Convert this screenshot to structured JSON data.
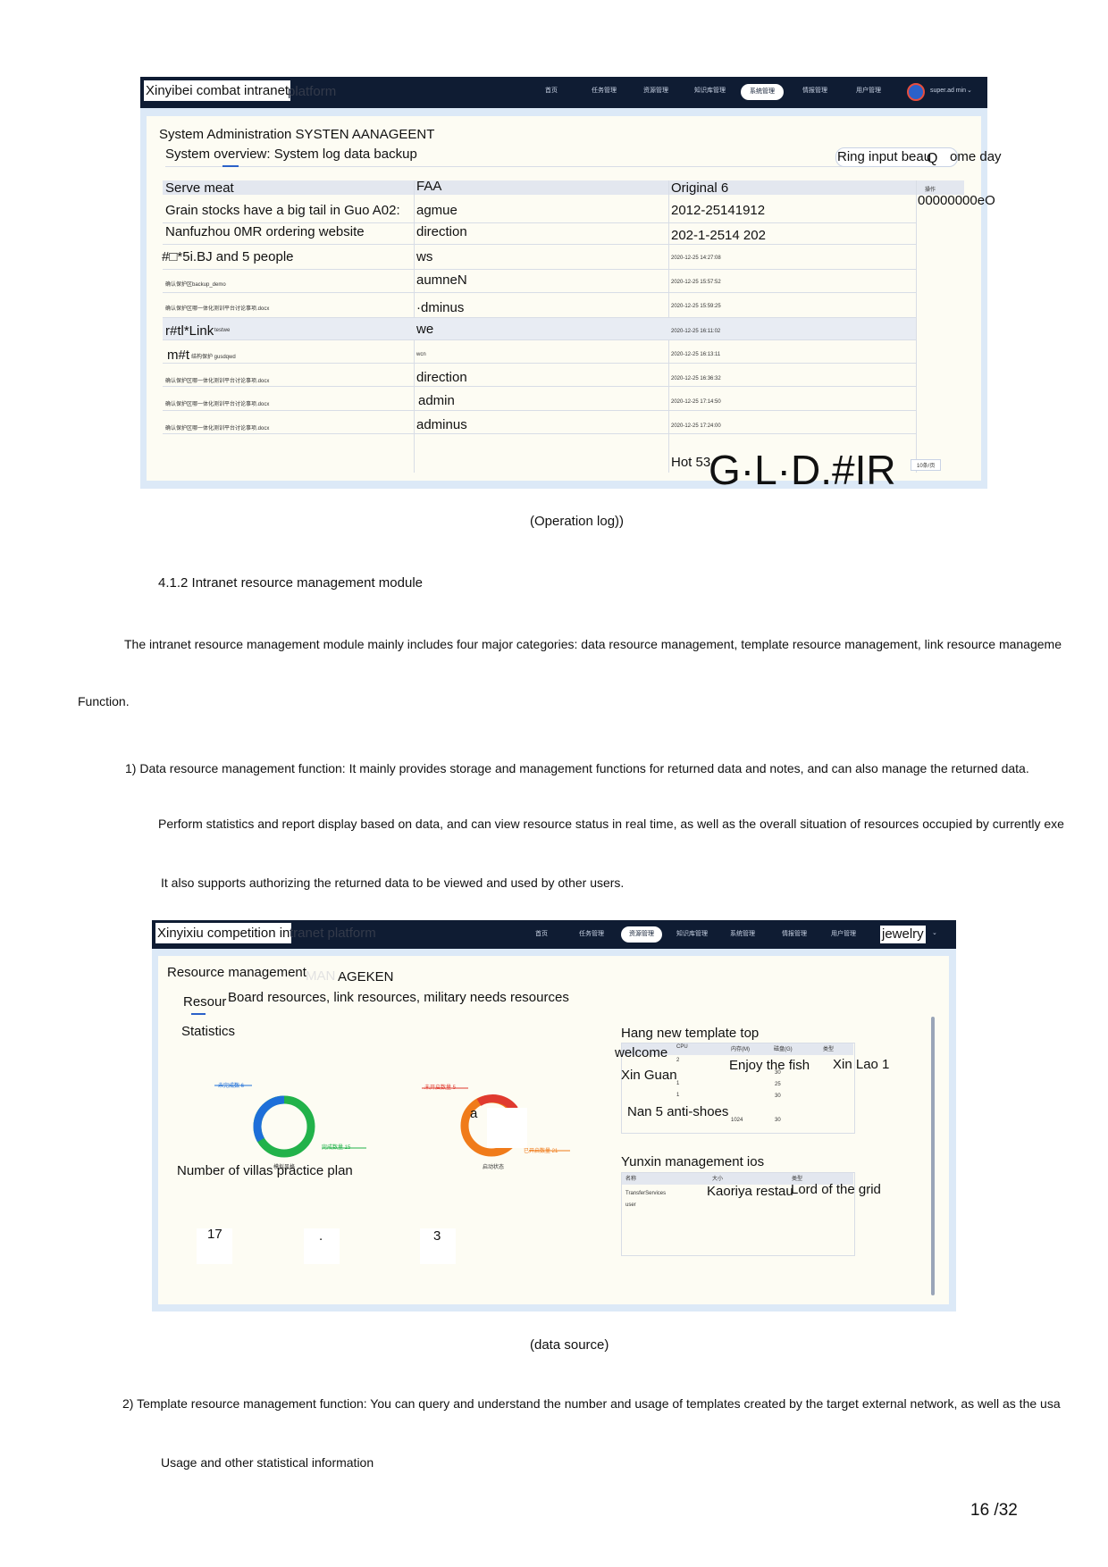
{
  "shot1": {
    "brand": "Xinyibei combat intranet",
    "brand_ghost": "platform",
    "nav": [
      "首页",
      "任务管理",
      "资源管理",
      "知识库管理",
      "系统管理",
      "情报管理",
      "用户管理"
    ],
    "nav_active_index": 4,
    "user": "super.ad min",
    "page_title": "System Administration SYSTEN AANAGEENT",
    "tabs": "System overview: System log data backup",
    "search_placeholder": "Ring input beau",
    "search_icon": "Q",
    "search_suffix": "ome day",
    "headers": {
      "c1": "Serve meat",
      "c2": "FAA",
      "c3": "Original 6",
      "c4": "操作"
    },
    "side_value": "00000000eO",
    "rows": [
      {
        "c1": "Grain stocks have a big tail in Guo A02:",
        "c2": "agmue",
        "c3": "2012-25141912"
      },
      {
        "c1": "Nanfuzhou 0MR ordering website",
        "c2": "direction",
        "c3": "202-1-2514 202"
      },
      {
        "c1": "#□*5i.BJ and 5 people",
        "c2": "ws",
        "c3": "2020-12-25 14:27:08"
      },
      {
        "c1": "确认保护区backup_demo",
        "c2": "aumneN",
        "c3": "2020-12-25 15:57:52"
      },
      {
        "c1": "确认保护区哪一体化测训平台讨论事项.docx",
        "c2": "·dminus",
        "c3": "2020-12-25 15:59:25"
      },
      {
        "c1": "r#tl*Link",
        "c1b": "testwe",
        "c2": "we",
        "c3": "2020-12-25 16:11:02"
      },
      {
        "c1": "m#t",
        "c1b": "结构保护 gusdqwd",
        "c2": "wcn",
        "c3": "2020-12-25 16:13:11"
      },
      {
        "c1": "确认保护区哪一体化测训平台讨论事项.docx",
        "c2": "direction",
        "c3": "2020-12-25 16:36:32"
      },
      {
        "c1": "确认保护区哪一体化测训平台讨论事项.docx",
        "c2": "admin",
        "c3": "2020-12-25 17:14:50"
      },
      {
        "c1": "确认保护区哪一体化测训平台讨论事项.docx",
        "c2": "adminus",
        "c3": "2020-12-25 17:24:00"
      }
    ],
    "footer_label": "Hot 53",
    "footer_big": "G·L·D.#IR",
    "page_size": "10条/页"
  },
  "caption1": "(Operation log))",
  "heading": "4.1.2 Intranet resource management module",
  "para1_line1": "The intranet resource management module mainly includes four major categories: data resource management, template resource management, link resource manageme",
  "para1_line2": "Function.",
  "item1_line1": "1) Data resource management function: It mainly provides storage and management functions for returned data and notes, and can also manage the returned data.",
  "item1_line2": "Perform statistics and report display based on data, and can view resource status in real time, as well as the overall situation of resources occupied by currently exe",
  "item1_line3": "It also supports authorizing the returned data to be viewed and used by other users.",
  "shot2": {
    "brand": "Xinyixiu competition in",
    "brand_ghost": "tranet platform",
    "nav": [
      "首页",
      "任务管理",
      "资源管理",
      "知识库管理",
      "系统管理",
      "情报管理",
      "用户管理"
    ],
    "nav_active_index": 2,
    "user": "jewelry",
    "title": "Resource management",
    "title_ghost": "MAN",
    "title_tail": "AGEKEN",
    "tabs_prefix": "Resour",
    "tabs": "Board resources, link resources, military needs resources",
    "stats_title": "Statistics",
    "donut1": {
      "label_a": "未完成数 6",
      "label_b": "完成数量 15",
      "caption": "模拟风格"
    },
    "donut2": {
      "label_a": "未开启数量 5",
      "label_b": "已开启数量 21",
      "caption": "启动状态",
      "center": "a"
    },
    "plan_title": "Number of villas practice plan",
    "plan_values": [
      "17",
      ".",
      "3"
    ],
    "template_title": "Hang new template top",
    "template_rows": [
      "welcome",
      "Xin Guan",
      "Nan 5 anti-shoes"
    ],
    "template_cols": [
      "Enjoy the fish",
      "Xin Lao 1"
    ],
    "template_headers": [
      "CPU",
      "内存(M)",
      "磁盘(G)",
      "类型"
    ],
    "template_small": [
      "2",
      "1",
      "1",
      "1024"
    ],
    "template_small2": [
      "30",
      "25",
      "30",
      "30"
    ],
    "cloud_title": "Yunxin management ios",
    "cloud_cols": [
      "Kaoriya restau",
      "Lord of the grid"
    ],
    "cloud_headers": [
      "名称",
      "大小",
      "类型"
    ],
    "cloud_row": "TransferServices",
    "cloud_row2": "user"
  },
  "caption2": "(data source)",
  "item2_line1": "2) Template resource management function: You can query and understand the number and usage of templates created by the target external network, as well as the usa",
  "item2_line2": "Usage and other statistical information",
  "page_number": "16 /32",
  "colors": {
    "topbar": "#0f1c33",
    "panel_bg": "#fdfcf3",
    "frame": "#dce9f7",
    "donut_blue": "#1e6fd9",
    "donut_green": "#22b24a",
    "donut_orange": "#f07b1a",
    "donut_red": "#e03a2f"
  }
}
